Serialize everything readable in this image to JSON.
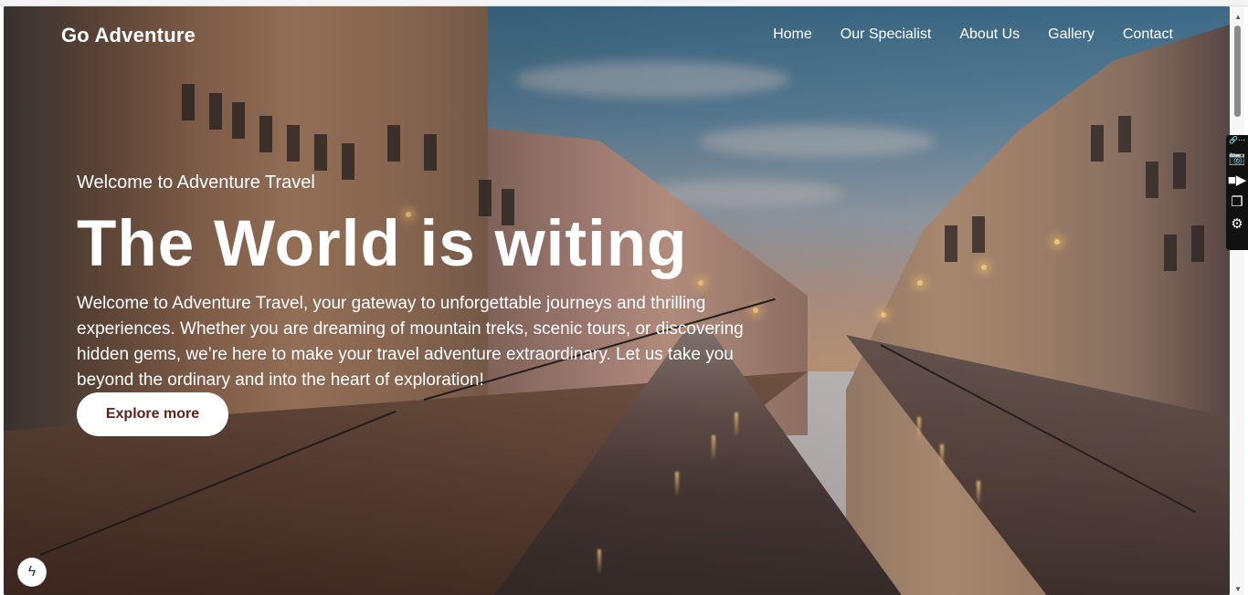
{
  "brand": {
    "name": "Go Adventure"
  },
  "nav": {
    "items": [
      "Home",
      "Our Specialist",
      "About Us",
      "Gallery",
      "Contact"
    ]
  },
  "hero": {
    "eyebrow": "Welcome to Adventure Travel",
    "headline": "The World is witing",
    "description": "Welcome to Adventure Travel, your gateway to unforgettable journeys and thrilling experiences. Whether you are dreaming of mountain treks, scenic tours, or discovering hidden gems, we’re here to make your travel adventure extraordinary. Let us take you beyond the ordinary and into the heart of exploration!",
    "cta_label": "Explore more"
  },
  "side_tools": {
    "icons": [
      "link-icon",
      "more-icon",
      "camera-icon",
      "video-icon",
      "copy-icon",
      "gear-icon"
    ]
  },
  "colors": {
    "cta_text": "#5a2418",
    "cta_bg": "#ffffff",
    "nav_text": "#ffffff"
  }
}
